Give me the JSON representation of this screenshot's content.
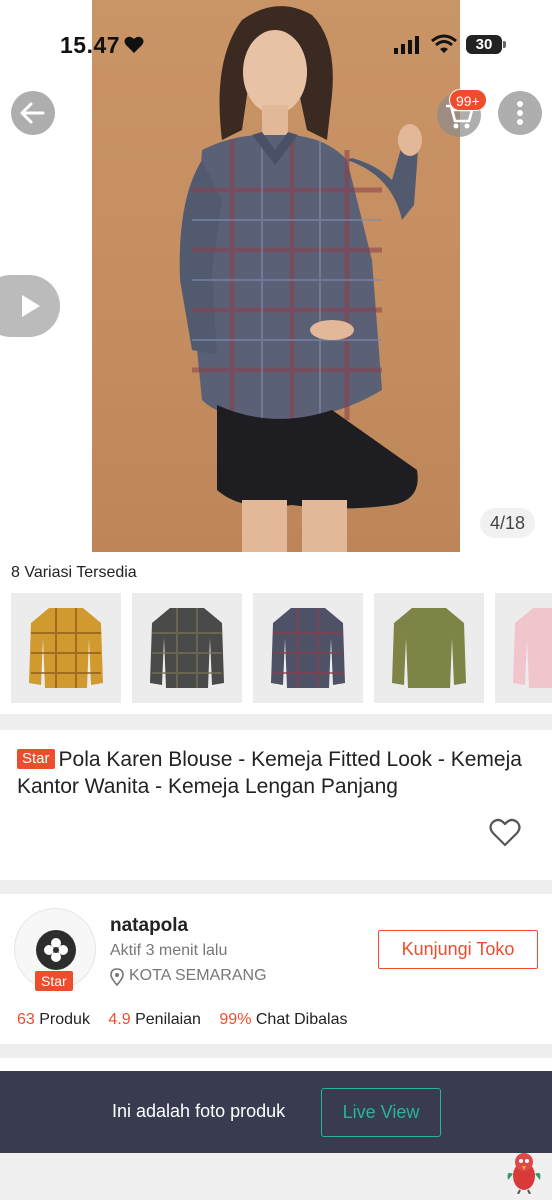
{
  "status_bar": {
    "time": "15.47",
    "battery": "30"
  },
  "header": {
    "cart_badge": "99+"
  },
  "gallery": {
    "counter": "4/18"
  },
  "variants": {
    "title": "8 Variasi Tersedia"
  },
  "product": {
    "badge": "Star",
    "title": "Pola Karen Blouse - Kemeja Fitted Look - Kemeja Kantor Wanita - Kemeja Lengan Panjang"
  },
  "shop": {
    "name": "natapola",
    "active": "Aktif 3 menit lalu",
    "location": "KOTA SEMARANG",
    "badge": "Star",
    "visit_label": "Kunjungi Toko",
    "stats": [
      {
        "value": "63",
        "label": "Produk"
      },
      {
        "value": "4.9",
        "label": "Penilaian"
      },
      {
        "value": "99%",
        "label": "Chat Dibalas"
      }
    ]
  },
  "banner": {
    "text": "Ini adalah foto produk",
    "live_label": "Live View"
  },
  "colors": {
    "accent": "#ee4d2d",
    "banner_bg": "#393c50",
    "live_green": "#28b49c"
  },
  "icons": [
    "heart-icon",
    "signal-icon",
    "wifi-icon",
    "back-arrow-icon",
    "cart-icon",
    "more-vertical-icon",
    "play-icon",
    "favorite-heart-icon",
    "location-pin-icon",
    "shop-flower-icon",
    "mascot-icon"
  ]
}
